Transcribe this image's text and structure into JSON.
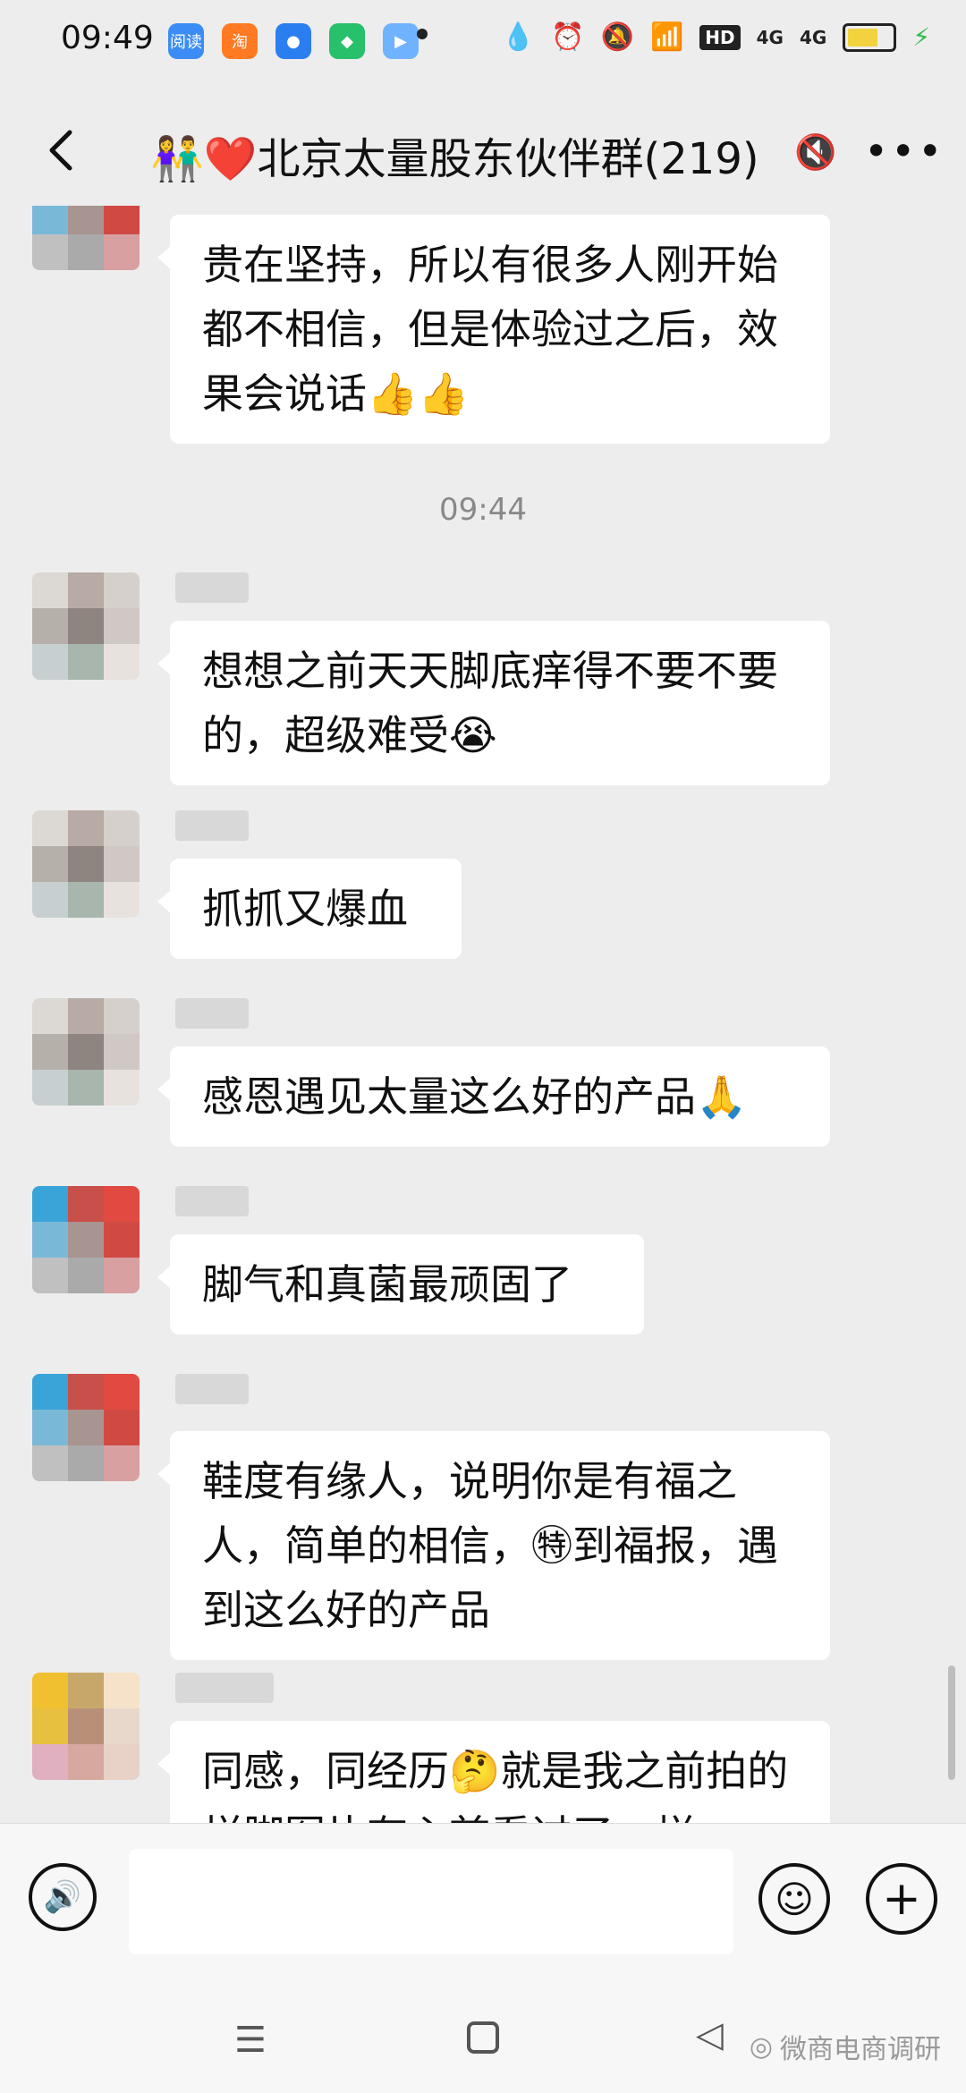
{
  "status_bar": {
    "time": "09:49",
    "apps": [
      "阅读",
      "淘",
      "●",
      "◆",
      "▶"
    ],
    "hd_label": "HD",
    "signal_1": "4G",
    "signal_2": "4G"
  },
  "title_bar": {
    "title": "👫❤️北京太量股东伙伴群(219)"
  },
  "messages": [
    {
      "text": "贵在坚持，所以有很多人刚开始都不相信，但是体验过之后，效果会说话👍👍"
    },
    {
      "timestamp": "09:44"
    },
    {
      "text": "想想之前天天脚底痒得不要不要的，超级难受😭"
    },
    {
      "text": "抓抓又爆血"
    },
    {
      "text": "感恩遇见太量这么好的产品🙏"
    },
    {
      "text": "脚气和真菌最顽固了"
    },
    {
      "text": "鞋度有缘人，说明你是有福之人，简单的相信，㊕到福报，遇到这么好的产品"
    },
    {
      "text": "同感，同经历🤔就是我之前拍的样脚图片有心首看过了一样"
    }
  ],
  "input_bar": {
    "message_value": "",
    "placeholder": ""
  },
  "watermark": "微商电商调研",
  "colors": {
    "background": "#ededed",
    "bubble": "#ffffff"
  }
}
